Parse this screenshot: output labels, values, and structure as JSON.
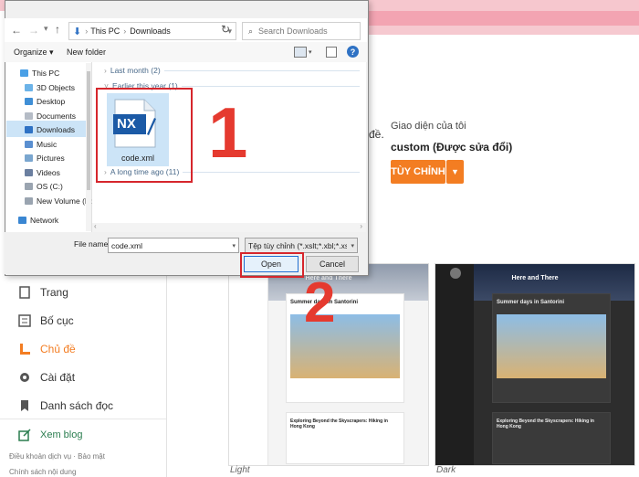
{
  "dialog": {
    "breadcrumb": [
      "This PC",
      "Downloads"
    ],
    "search_placeholder": "Search Downloads",
    "toolbar": {
      "organize": "Organize ▾",
      "new_folder": "New folder",
      "help": "?"
    },
    "tree": [
      {
        "label": "This PC",
        "icon": "pc-icon"
      },
      {
        "label": "3D Objects",
        "icon": "folder-3d-icon"
      },
      {
        "label": "Desktop",
        "icon": "desktop-folder-icon"
      },
      {
        "label": "Documents",
        "icon": "documents-folder-icon"
      },
      {
        "label": "Downloads",
        "icon": "downloads-folder-icon",
        "selected": true
      },
      {
        "label": "Music",
        "icon": "music-icon"
      },
      {
        "label": "Pictures",
        "icon": "pictures-icon"
      },
      {
        "label": "Videos",
        "icon": "videos-icon"
      },
      {
        "label": "OS (C:)",
        "icon": "drive-icon"
      },
      {
        "label": "New Volume (E:)",
        "icon": "drive-icon"
      },
      {
        "label": "Network",
        "icon": "network-icon"
      }
    ],
    "groups": {
      "last_month": "Last month (2)",
      "earlier_this_year": "Earlier this year (1)",
      "long_time_ago": "A long time ago (11)"
    },
    "file": {
      "name": "code.xml",
      "icon_text": "NX"
    },
    "file_name_label": "File name:",
    "file_name_value": "code.xml",
    "file_type_value": "Tệp tùy chỉnh (*.xslt;*.xbl;*.xsl;*.x",
    "open_label": "Open",
    "cancel_label": "Cancel"
  },
  "annotations": {
    "step1": "1",
    "step2": "2"
  },
  "blogger": {
    "peek_text": "đề.",
    "theme_heading": "Giao diện của tôi",
    "theme_name": "custom (Được sửa đổi)",
    "customize_label": "TÙY CHỈNH",
    "nav": [
      {
        "label": "Trang",
        "icon": "pages-icon"
      },
      {
        "label": "Bố cục",
        "icon": "layout-icon"
      },
      {
        "label": "Chủ đề",
        "icon": "theme-icon",
        "active": true
      },
      {
        "label": "Cài đặt",
        "icon": "settings-icon"
      },
      {
        "label": "Danh sách đọc",
        "icon": "reading-list-icon"
      }
    ],
    "view_blog": "Xem blog",
    "footer_links": [
      "Điều khoản dịch vụ",
      "Bảo mật"
    ],
    "footer_links2": "Chính sách nội dung",
    "thumbnails": [
      {
        "caption": "Light",
        "blog_title": "Here and There",
        "post1": "Summer days in Santorini",
        "post2": "Exploring Beyond the Skyscrapers: Hiking in Hong Kong"
      },
      {
        "caption": "Dark",
        "blog_title": "Here and There",
        "post1": "Summer days in Santorini",
        "post2": "Exploring Beyond the Skyscrapers: Hiking in Hong Kong"
      }
    ]
  },
  "colors": {
    "accent_orange": "#f37d22",
    "active_nav": "#f37d22",
    "annotation_red": "#e53a2f",
    "blogger_pink": "#f3a4b2"
  }
}
